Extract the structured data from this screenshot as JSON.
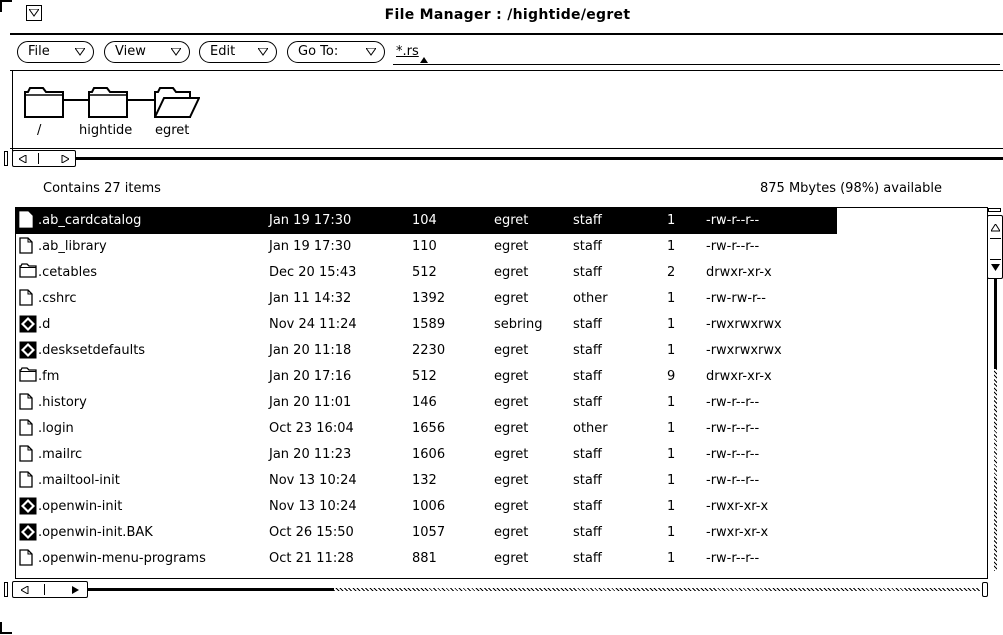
{
  "window": {
    "title": "File Manager : /hightide/egret"
  },
  "menus": {
    "file": "File",
    "view": "View",
    "edit": "Edit",
    "goto": "Go To:"
  },
  "goto_value": "*.rs",
  "path": {
    "segments": [
      "/",
      "hightide",
      "egret"
    ]
  },
  "info": {
    "count": "Contains 27 items",
    "available": "875 Mbytes (98%) available"
  },
  "files": [
    {
      "name": ".ab_cardcatalog",
      "date": "Jan 19 17:30",
      "size": "104",
      "owner": "egret",
      "group": "staff",
      "links": "1",
      "perms": "-rw-r--r--",
      "icon": "document-icon",
      "selected": true
    },
    {
      "name": ".ab_library",
      "date": "Jan 19 17:30",
      "size": "110",
      "owner": "egret",
      "group": "staff",
      "links": "1",
      "perms": "-rw-r--r--",
      "icon": "document-icon"
    },
    {
      "name": ".cetables",
      "date": "Dec 20 15:43",
      "size": "512",
      "owner": "egret",
      "group": "staff",
      "links": "2",
      "perms": "drwxr-xr-x",
      "icon": "folder-icon"
    },
    {
      "name": ".cshrc",
      "date": "Jan 11 14:32",
      "size": "1392",
      "owner": "egret",
      "group": "other",
      "links": "1",
      "perms": "-rw-rw-r--",
      "icon": "document-icon"
    },
    {
      "name": ".d",
      "date": "Nov 24 11:24",
      "size": "1589",
      "owner": "sebring",
      "group": "staff",
      "links": "1",
      "perms": "-rwxrwxrwx",
      "icon": "executable-icon"
    },
    {
      "name": ".desksetdefaults",
      "date": "Jan 20 11:18",
      "size": "2230",
      "owner": "egret",
      "group": "staff",
      "links": "1",
      "perms": "-rwxrwxrwx",
      "icon": "executable-icon"
    },
    {
      "name": ".fm",
      "date": "Jan 20 17:16",
      "size": "512",
      "owner": "egret",
      "group": "staff",
      "links": "9",
      "perms": "drwxr-xr-x",
      "icon": "folder-icon"
    },
    {
      "name": ".history",
      "date": "Jan 20 11:01",
      "size": "146",
      "owner": "egret",
      "group": "staff",
      "links": "1",
      "perms": "-rw-r--r--",
      "icon": "document-icon"
    },
    {
      "name": ".login",
      "date": "Oct 23 16:04",
      "size": "1656",
      "owner": "egret",
      "group": "other",
      "links": "1",
      "perms": "-rw-r--r--",
      "icon": "document-icon"
    },
    {
      "name": ".mailrc",
      "date": "Jan 20 11:23",
      "size": "1606",
      "owner": "egret",
      "group": "staff",
      "links": "1",
      "perms": "-rw-r--r--",
      "icon": "document-icon"
    },
    {
      "name": ".mailtool-init",
      "date": "Nov 13 10:24",
      "size": "132",
      "owner": "egret",
      "group": "staff",
      "links": "1",
      "perms": "-rw-r--r--",
      "icon": "document-icon"
    },
    {
      "name": ".openwin-init",
      "date": "Nov 13 10:24",
      "size": "1006",
      "owner": "egret",
      "group": "staff",
      "links": "1",
      "perms": "-rwxr-xr-x",
      "icon": "executable-icon"
    },
    {
      "name": ".openwin-init.BAK",
      "date": "Oct 26 15:50",
      "size": "1057",
      "owner": "egret",
      "group": "staff",
      "links": "1",
      "perms": "-rwxr-xr-x",
      "icon": "executable-icon"
    },
    {
      "name": ".openwin-menu-programs",
      "date": "Oct 21 11:28",
      "size": "881",
      "owner": "egret",
      "group": "staff",
      "links": "1",
      "perms": "-rw-r--r--",
      "icon": "document-icon"
    }
  ]
}
